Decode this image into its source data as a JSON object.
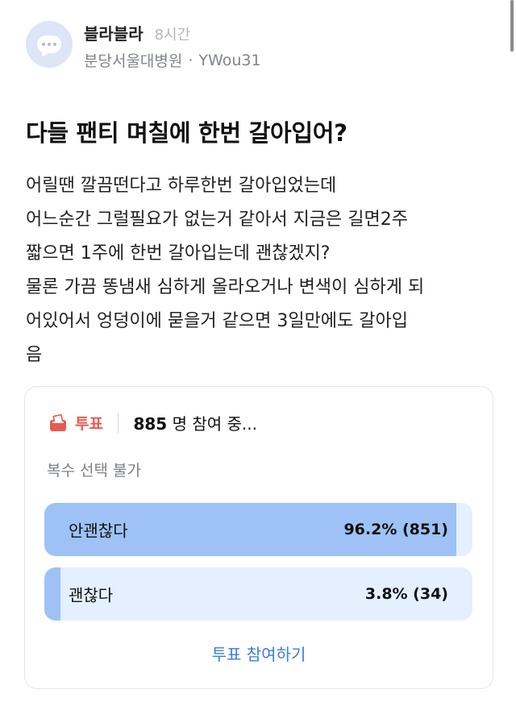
{
  "post": {
    "board": "블라블라",
    "time": "8시간",
    "company": "분당서울대병원",
    "separator": "·",
    "author": "YWou31",
    "title": "다들 팬티 며칠에 한번 갈아입어?",
    "body_lines": [
      "어릴땐 깔끔떤다고 하루한번 갈아입었는데",
      "어느순간 그럴필요가 없는거 같아서 지금은 길면2주",
      "짧으면 1주에 한번 갈아입는데 괜찮겠지?",
      "물론 가끔 똥냄새 심하게 올라오거나 변색이 심하게 되",
      "어있어서 엉덩이에 묻을거 같으면 3일만에도 갈아입",
      "음"
    ]
  },
  "poll": {
    "label": "투표",
    "participants": "885",
    "participants_suffix": "명 참여 중...",
    "subtitle": "복수 선택 불가",
    "options": [
      {
        "label": "안괜찮다",
        "result": "96.2% (851)",
        "fraction": 0.962
      },
      {
        "label": "괜찮다",
        "result": "3.8% (34)",
        "fraction": 0.038
      }
    ],
    "vote_button": "투표 참여하기"
  },
  "colors": {
    "accent_red": "#e85a4f",
    "bar_fill": "#9ec2f5",
    "bar_track": "#e4efff",
    "link_blue": "#3a7be0"
  },
  "icons": {
    "avatar": "chat-bubble-icon",
    "poll": "ballot-box-icon"
  }
}
